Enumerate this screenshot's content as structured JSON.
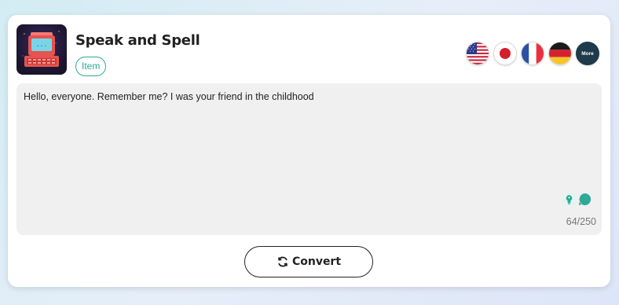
{
  "item": {
    "title": "Speak and Spell",
    "tag": "Item"
  },
  "languages": [
    {
      "name": "us-flag-icon",
      "code": "en-US"
    },
    {
      "name": "jp-flag-icon",
      "code": "ja"
    },
    {
      "name": "fr-flag-icon",
      "code": "fr"
    },
    {
      "name": "de-flag-icon",
      "code": "de"
    }
  ],
  "more_label": "More",
  "editor": {
    "value": "Hello, everyone. Remember me? I was your friend in the childhood",
    "counter": "64/250"
  },
  "convert_label": "Convert",
  "colors": {
    "accent": "#2ea897",
    "textarea_bg": "#eff0ef",
    "more_bg": "#1f3a4a"
  }
}
